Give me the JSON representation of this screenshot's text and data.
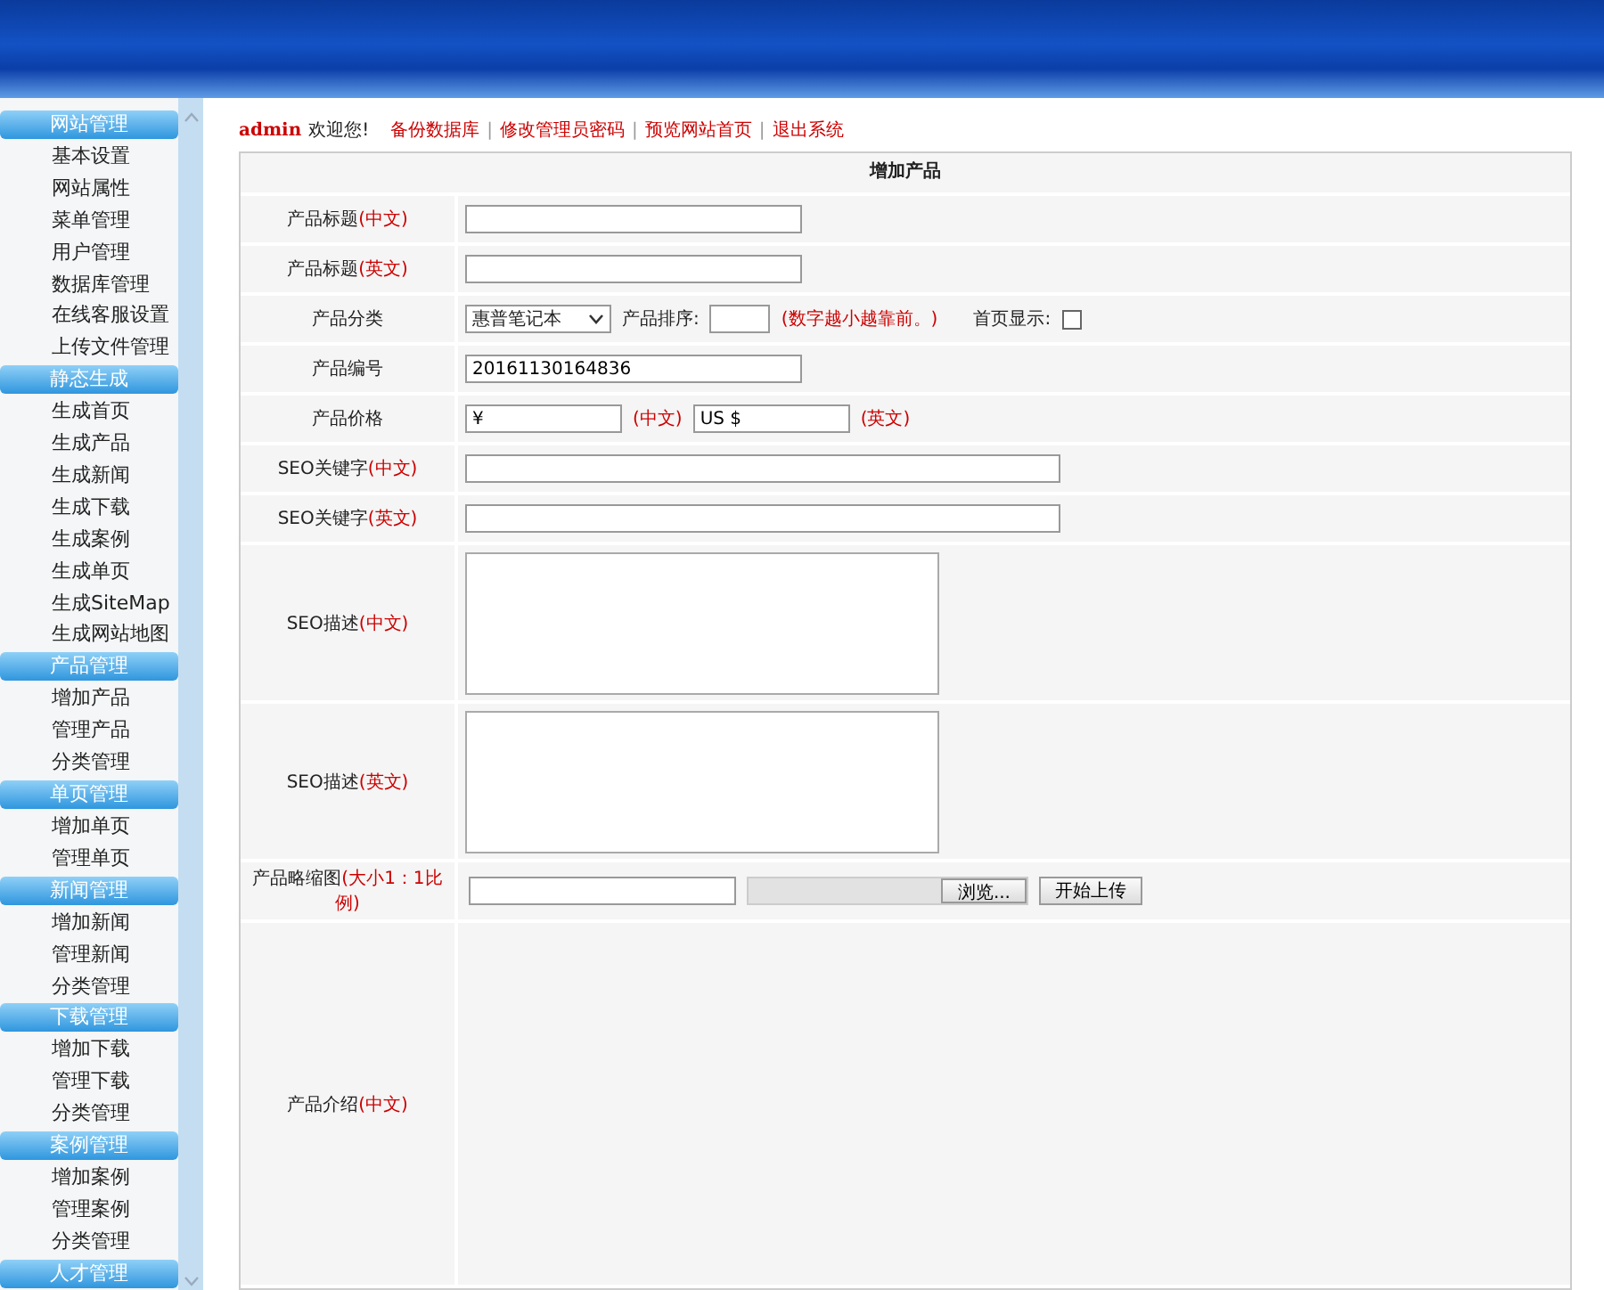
{
  "sidebar": {
    "groups": [
      {
        "title": "网站管理",
        "items": [
          "基本设置",
          "网站属性",
          "菜单管理",
          "用户管理",
          "数据库管理",
          "在线客服设置",
          "上传文件管理"
        ]
      },
      {
        "title": "静态生成",
        "items": [
          "生成首页",
          "生成产品",
          "生成新闻",
          "生成下载",
          "生成案例",
          "生成单页",
          "生成SiteMap",
          "生成网站地图"
        ]
      },
      {
        "title": "产品管理",
        "items": [
          "增加产品",
          "管理产品",
          "分类管理"
        ]
      },
      {
        "title": "单页管理",
        "items": [
          "增加单页",
          "管理单页"
        ]
      },
      {
        "title": "新闻管理",
        "items": [
          "增加新闻",
          "管理新闻",
          "分类管理"
        ]
      },
      {
        "title": "下载管理",
        "items": [
          "增加下载",
          "管理下载",
          "分类管理"
        ]
      },
      {
        "title": "案例管理",
        "items": [
          "增加案例",
          "管理案例",
          "分类管理"
        ]
      },
      {
        "title": "人才管理"
      }
    ]
  },
  "topbar": {
    "user": "admin",
    "welcome": "欢迎您!",
    "separator": "|",
    "links": [
      "备份数据库",
      "修改管理员密码",
      "预览网站首页",
      "退出系统"
    ]
  },
  "form": {
    "title": "增加产品",
    "rows": [
      {
        "kind": "text",
        "label": "产品标题",
        "note": "(中文)",
        "value": ""
      },
      {
        "kind": "text",
        "label": "产品标题",
        "note": "(英文)",
        "value": ""
      },
      {
        "kind": "category",
        "label": "产品分类",
        "select": "惠普笔记本",
        "sort_label": "产品排序:",
        "sort_value": "",
        "sort_note": "(数字越小越靠前。)",
        "home_label": "首页显示:",
        "home_checked": false
      },
      {
        "kind": "text",
        "label": "产品编号",
        "value": "20161130164836"
      },
      {
        "kind": "price",
        "label": "产品价格",
        "cn_value": "¥",
        "cn_note": "(中文)",
        "en_value": "US $",
        "en_note": "(英文)"
      },
      {
        "kind": "wide_text",
        "label": "SEO关键字",
        "note": "(中文)",
        "value": ""
      },
      {
        "kind": "wide_text",
        "label": "SEO关键字",
        "note": "(英文)",
        "value": ""
      },
      {
        "kind": "textarea",
        "label": "SEO描述",
        "note": "(中文)"
      },
      {
        "kind": "textarea",
        "label": "SEO描述",
        "note": "(英文)"
      },
      {
        "kind": "upload",
        "label": "产品略缩图",
        "note": "(大小1：1比例)",
        "browse": "浏览...",
        "upload": "开始上传"
      },
      {
        "kind": "editor",
        "label": "产品介绍",
        "note": "(中文)"
      }
    ]
  }
}
